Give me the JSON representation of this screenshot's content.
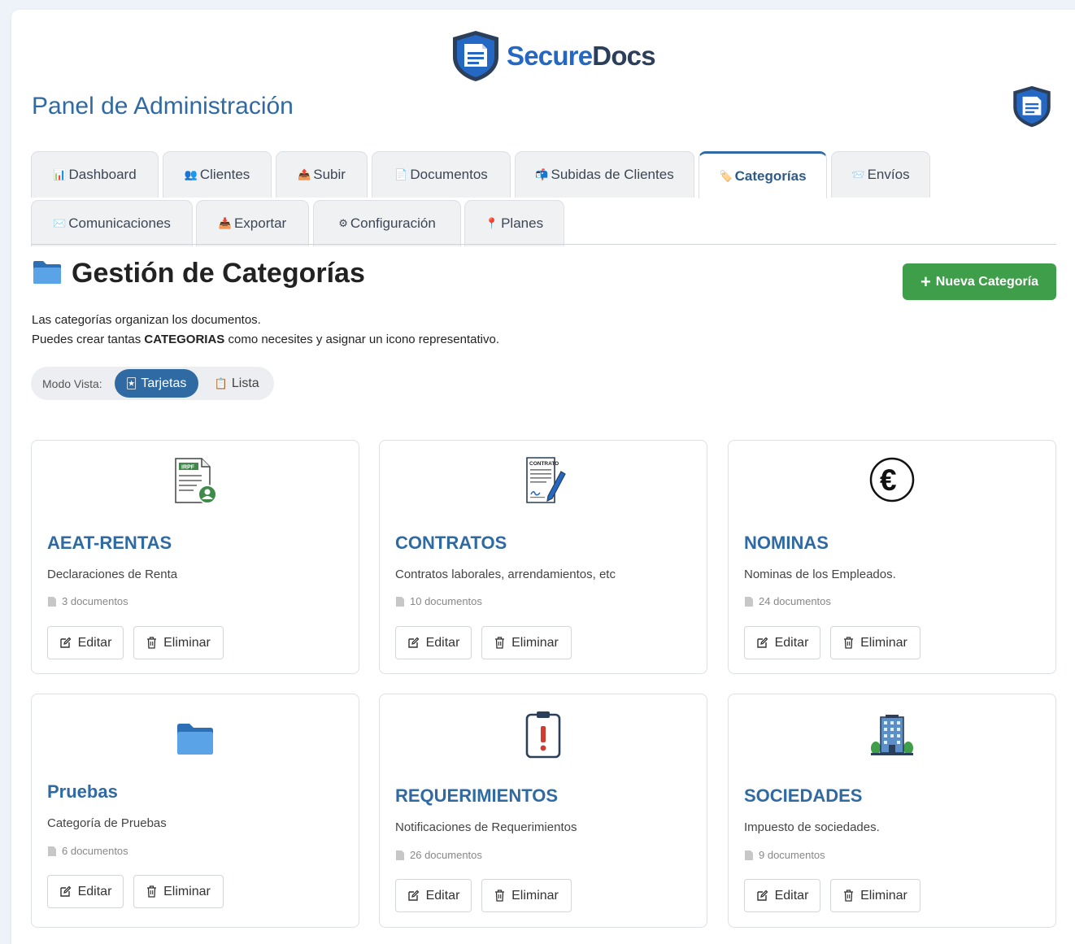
{
  "brand": {
    "part1": "Secure",
    "part2": "Docs"
  },
  "page_title": "Panel de Administración",
  "tabs": [
    {
      "label": "Dashboard",
      "icon": "📊"
    },
    {
      "label": "Clientes",
      "icon": "👥"
    },
    {
      "label": "Subir",
      "icon": "📤"
    },
    {
      "label": "Documentos",
      "icon": "📄"
    },
    {
      "label": "Subidas de Clientes",
      "icon": "📬"
    },
    {
      "label": "Categorías",
      "icon": "🏷️"
    },
    {
      "label": "Envíos",
      "icon": "📨"
    },
    {
      "label": "Comunicaciones",
      "icon": "✉️"
    },
    {
      "label": "Exportar",
      "icon": "📥"
    },
    {
      "label": "Configuración",
      "icon": "⚙"
    },
    {
      "label": "Planes",
      "icon": "📍"
    }
  ],
  "active_tab": "Categorías",
  "section": {
    "title": "Gestión de Categorías",
    "new_button": "Nueva Categoría"
  },
  "intro": {
    "line1": "Las categorías organizan los documentos.",
    "line2_pre": "Puedes crear tantas ",
    "line2_bold": "CATEGORIAS",
    "line2_post": " como necesites y asignar un icono representativo."
  },
  "view_mode": {
    "label": "Modo Vista:",
    "cards": "Tarjetas",
    "list": "Lista",
    "selected": "Tarjetas"
  },
  "actions": {
    "edit": "Editar",
    "delete": "Eliminar"
  },
  "categories": [
    {
      "name": "AEAT-RENTAS",
      "description": "Declaraciones de Renta",
      "count": "3 documentos",
      "icon": "irpf-document-icon"
    },
    {
      "name": "CONTRATOS",
      "description": "Contratos laborales, arrendamientos, etc",
      "count": "10 documentos",
      "icon": "contract-icon"
    },
    {
      "name": "NOMINAS",
      "description": "Nominas de los Empleados.",
      "count": "24 documentos",
      "icon": "euro-icon"
    },
    {
      "name": "Pruebas",
      "description": "Categoría de Pruebas",
      "count": "6 documentos",
      "icon": "folder-icon"
    },
    {
      "name": "REQUERIMIENTOS",
      "description": "Notificaciones de Requerimientos",
      "count": "26 documentos",
      "icon": "clipboard-alert-icon"
    },
    {
      "name": "SOCIEDADES",
      "description": "Impuesto de sociedades.",
      "count": "9 documentos",
      "icon": "office-building-icon"
    }
  ],
  "colors": {
    "accent": "#2f6aa3",
    "new_button": "#3f9e4a",
    "brand_blue": "#2468c4",
    "brand_dark": "#2b3e5a"
  }
}
